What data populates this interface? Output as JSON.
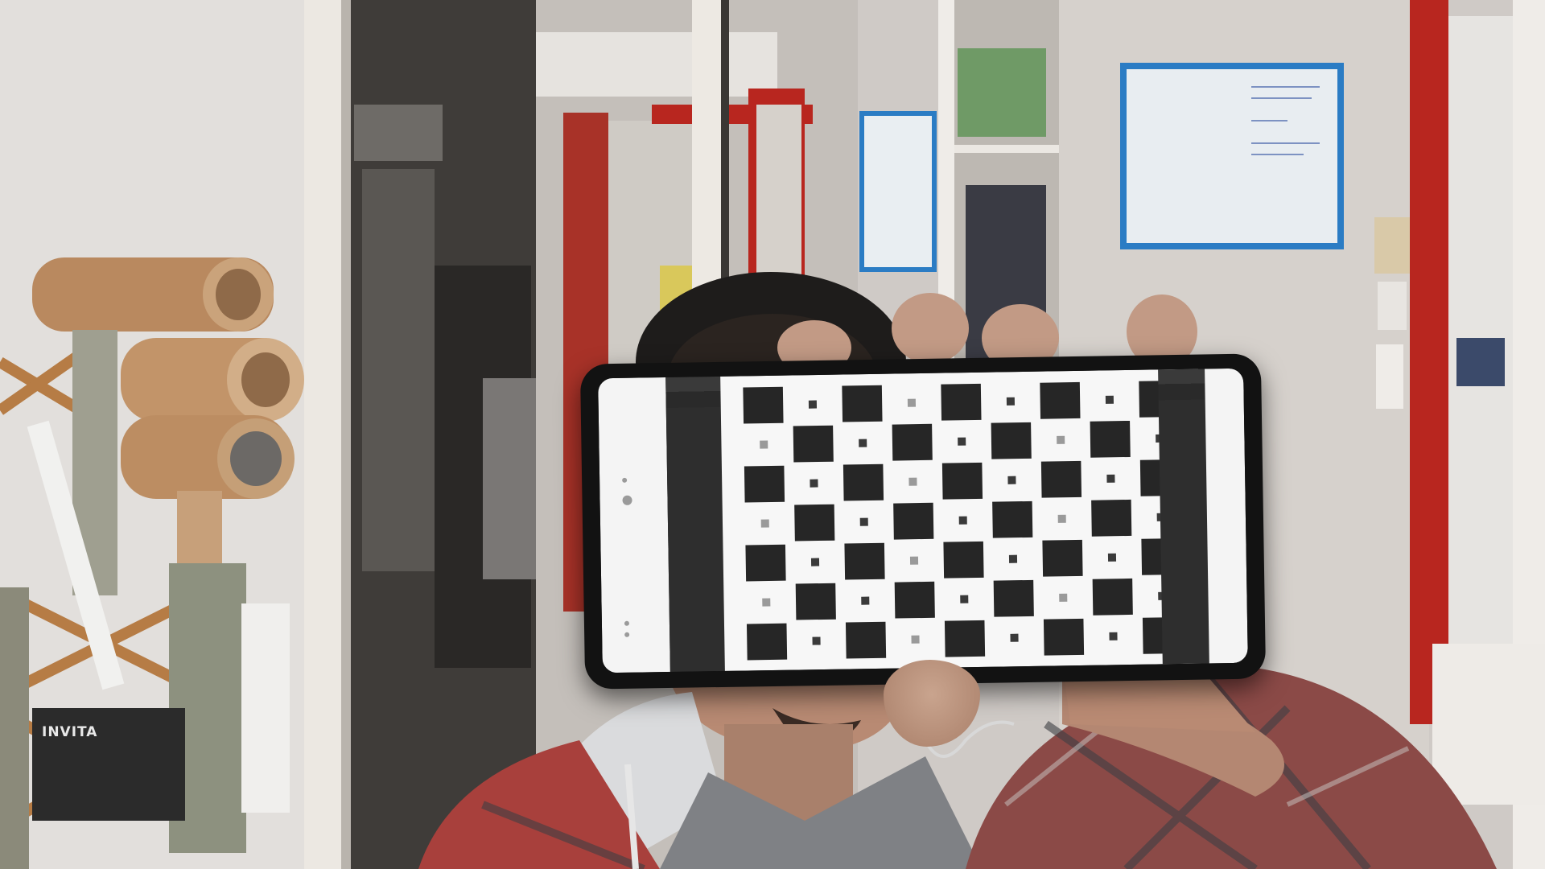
{
  "scene": {
    "description_visible_text": "INVITA",
    "colors": {
      "wall": "#d8d3cf",
      "door_frame_red": "#b8261f",
      "whiteboard_frame_blue": "#2b7cc4",
      "shirt_red": "#a8403c",
      "shirt_gray": "#7f8185",
      "skin": "#b98a73",
      "cardboard": "#b9895f",
      "phone_body": "#121212",
      "board_black": "#262626",
      "board_white": "#f7f7f7"
    }
  },
  "phone": {
    "board": {
      "pattern": "charuco",
      "cols": 9,
      "rows": 7
    }
  }
}
